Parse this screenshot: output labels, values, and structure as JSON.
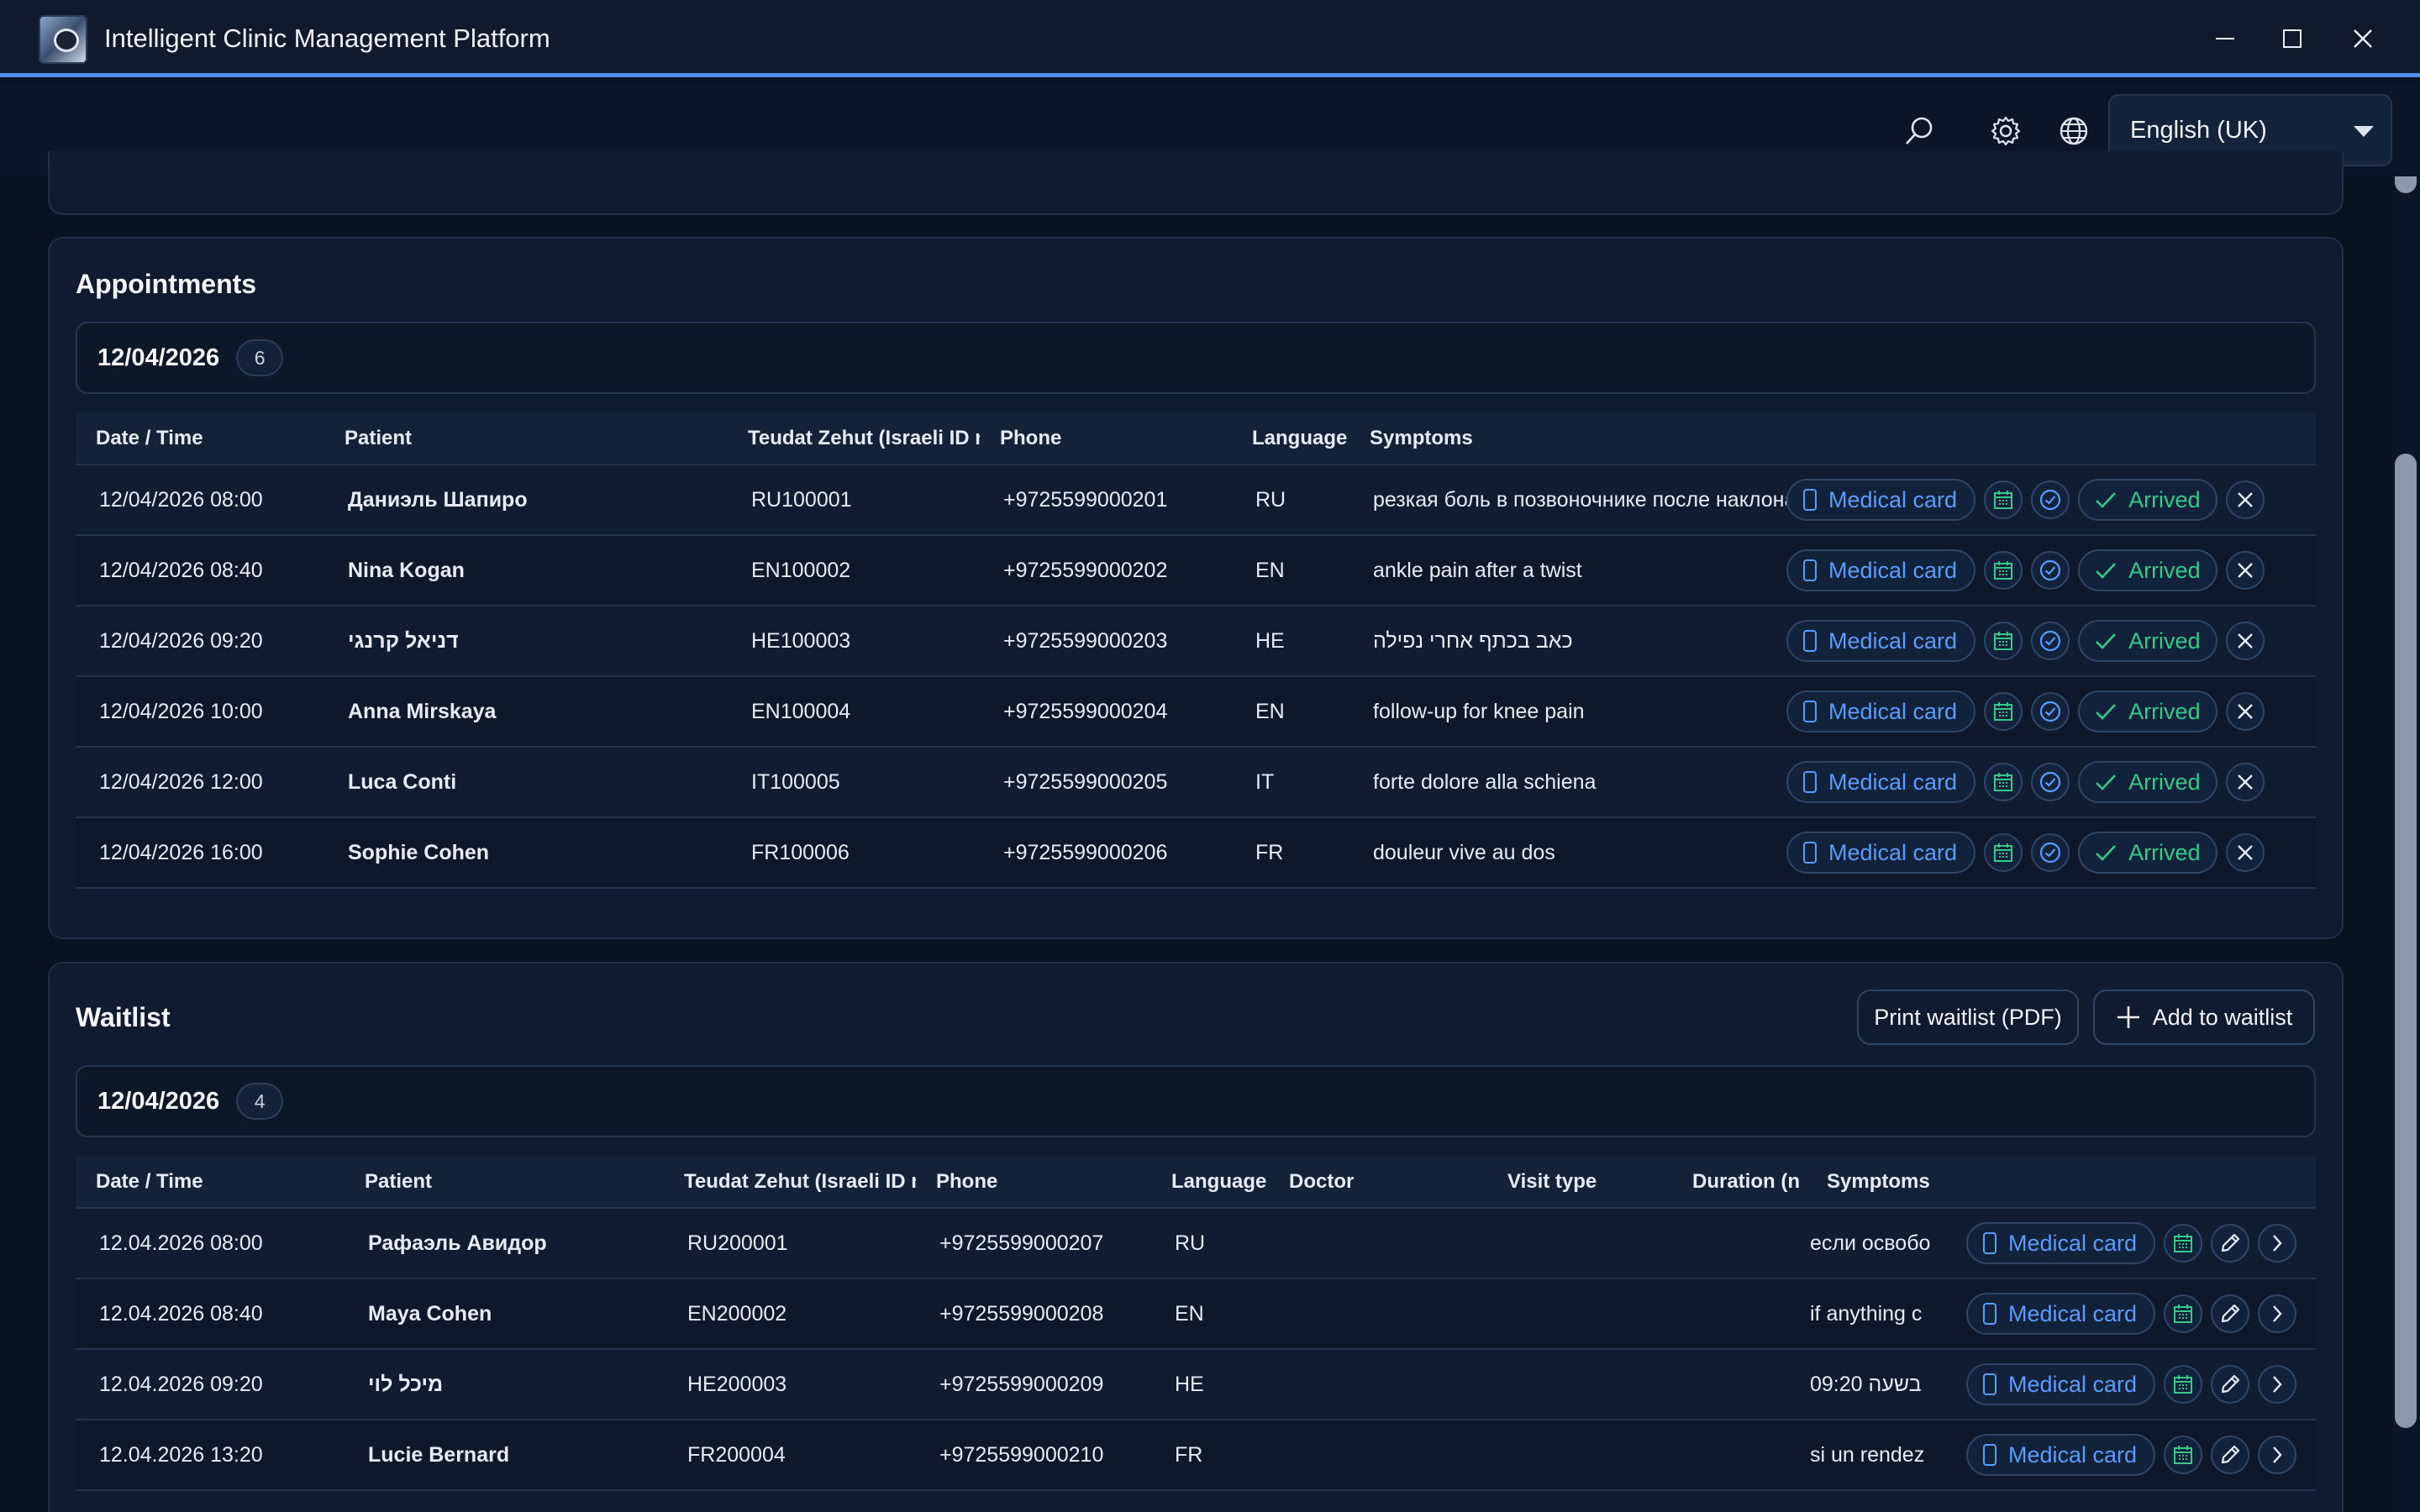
{
  "app": {
    "title": "Intelligent Clinic Management Platform"
  },
  "toolbar": {
    "language_selected": "English (UK)"
  },
  "icons": {
    "search": "search-icon",
    "settings": "gear-icon",
    "language": "globe-icon",
    "calendar": "calendar-icon",
    "confirm": "check-circle-icon",
    "cancel": "close-icon",
    "edit": "pencil-icon",
    "more": "chevron-right-icon",
    "add": "plus-icon"
  },
  "colors": {
    "accent": "#4f8fe8",
    "link": "#5b9cff",
    "success": "#35c98a",
    "calendar": "#36c98a"
  },
  "appointments": {
    "heading": "Appointments",
    "date": "12/04/2026",
    "count": "6",
    "columns": [
      "Date / Time",
      "Patient",
      "Teudat Zehut (Israeli ID n",
      "Phone",
      "Language",
      "Symptoms"
    ],
    "medical_card_label": "Medical card",
    "arrived_label": "Arrived",
    "rows": [
      {
        "datetime": "12/04/2026 08:00",
        "patient": "Даниэль Шапиро",
        "id": "RU100001",
        "phone": "+9725599000201",
        "lang": "RU",
        "symptoms": "резкая боль в позвоночнике после наклона"
      },
      {
        "datetime": "12/04/2026 08:40",
        "patient": "Nina Kogan",
        "id": "EN100002",
        "phone": "+9725599000202",
        "lang": "EN",
        "symptoms": "ankle pain after a twist"
      },
      {
        "datetime": "12/04/2026 09:20",
        "patient": "דניאל קרנגי",
        "id": "HE100003",
        "phone": "+9725599000203",
        "lang": "HE",
        "symptoms": "כאב בכתף אחרי נפילה"
      },
      {
        "datetime": "12/04/2026 10:00",
        "patient": "Anna Mirskaya",
        "id": "EN100004",
        "phone": "+9725599000204",
        "lang": "EN",
        "symptoms": "follow-up for knee pain"
      },
      {
        "datetime": "12/04/2026 12:00",
        "patient": "Luca Conti",
        "id": "IT100005",
        "phone": "+9725599000205",
        "lang": "IT",
        "symptoms": "forte dolore alla schiena"
      },
      {
        "datetime": "12/04/2026 16:00",
        "patient": "Sophie Cohen",
        "id": "FR100006",
        "phone": "+9725599000206",
        "lang": "FR",
        "symptoms": "douleur vive au dos"
      }
    ]
  },
  "waitlist": {
    "heading": "Waitlist",
    "print_label": "Print waitlist (PDF)",
    "add_label": "Add to waitlist",
    "date": "12/04/2026",
    "count": "4",
    "columns": [
      "Date / Time",
      "Patient",
      "Teudat Zehut (Israeli ID n",
      "Phone",
      "Language",
      "Doctor",
      "Visit type",
      "Duration (n",
      "Symptoms"
    ],
    "medical_card_label": "Medical card",
    "rows": [
      {
        "datetime": "12.04.2026 08:00",
        "patient": "Рафаэль Авидор",
        "id": "RU200001",
        "phone": "+9725599000207",
        "lang": "RU",
        "doctor": "",
        "visit": "",
        "duration": "",
        "symptoms": "если освобо"
      },
      {
        "datetime": "12.04.2026 08:40",
        "patient": "Maya Cohen",
        "id": "EN200002",
        "phone": "+9725599000208",
        "lang": "EN",
        "doctor": "",
        "visit": "",
        "duration": "",
        "symptoms": "if anything c"
      },
      {
        "datetime": "12.04.2026 09:20",
        "patient": "מיכל לוי",
        "id": "HE200003",
        "phone": "+9725599000209",
        "lang": "HE",
        "doctor": "",
        "visit": "",
        "duration": "",
        "symptoms": "בשעה 09:20"
      },
      {
        "datetime": "12.04.2026 13:20",
        "patient": "Lucie Bernard",
        "id": "FR200004",
        "phone": "+9725599000210",
        "lang": "FR",
        "doctor": "",
        "visit": "",
        "duration": "",
        "symptoms": "si un rendez"
      }
    ]
  }
}
